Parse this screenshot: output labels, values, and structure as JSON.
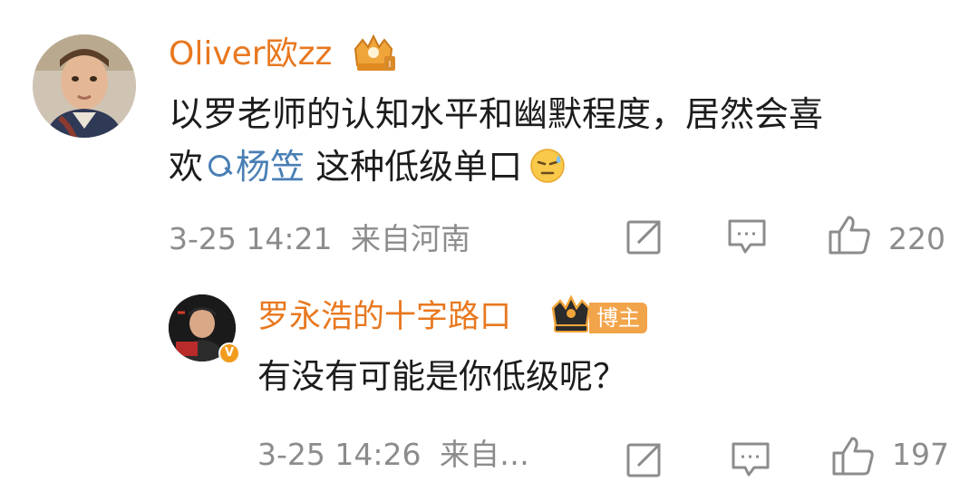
{
  "main_comment": {
    "username": "Oliver欧zz",
    "text_line1": "以罗老师的认知水平和幽默程度，居然会喜",
    "text_line2_prefix": "欢",
    "topic_link": "杨笠",
    "text_line2_suffix": " 这种低级单口",
    "timestamp": "3-25 14:21",
    "location": "来自河南",
    "like_count": "220",
    "emoji": "sweat-face-emoji"
  },
  "reply": {
    "username": "罗永浩的十字路口",
    "role_tag": "博主",
    "verified_mark": "V",
    "text": "有没有可能是你低级呢？",
    "timestamp": "3-25 14:26",
    "location": "来自…",
    "like_count": "197"
  },
  "colors": {
    "username": "#e8781f",
    "link": "#4a7fb5",
    "meta": "#8c8c8c",
    "tag": "#f2a44a"
  },
  "icons": {
    "share": "share-icon",
    "comment": "comment-icon",
    "like": "thumbs-up-icon",
    "crown": "crown-badge-icon",
    "search": "search-icon"
  }
}
